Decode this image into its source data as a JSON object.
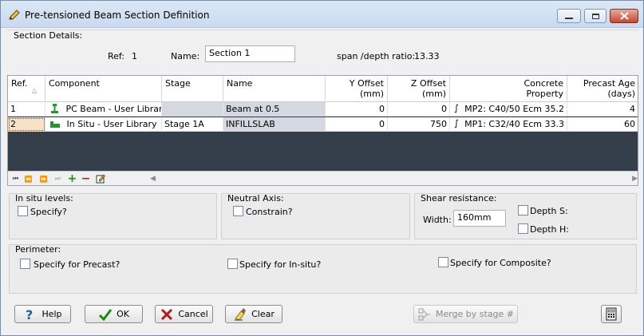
{
  "window": {
    "title": "Pre-tensioned Beam Section Definition"
  },
  "section_details": {
    "group_label": "Section Details:",
    "ref_label": "Ref:",
    "ref_value": "1",
    "name_label": "Name:",
    "name_value": "Section 1",
    "ratio_label": "span /depth ratio:",
    "ratio_value": "13.33"
  },
  "grid": {
    "headers": {
      "ref": "Ref.",
      "component": "Component",
      "stage": "Stage",
      "name": "Name",
      "y_offset_1": "Y Offset",
      "y_offset_2": "(mm)",
      "z_offset_1": "Z Offset",
      "z_offset_2": "(mm)",
      "concrete_1": "Concrete",
      "concrete_2": "Property",
      "age_1": "Precast Age",
      "age_2": "(days)"
    },
    "rows": [
      {
        "ref": "1",
        "component": "PC Beam - User Library",
        "stage": "",
        "name": "Beam at 0.5",
        "y_offset": "0",
        "z_offset": "0",
        "concrete": "MP2: C40/50 Ecm 35.2",
        "age": "4"
      },
      {
        "ref": "2",
        "component": "In Situ - User Library",
        "stage": "Stage 1A",
        "name": "INFILLSLAB",
        "y_offset": "0",
        "z_offset": "750",
        "concrete": "MP1: C32/40 Ecm 33.3",
        "age": "60"
      }
    ]
  },
  "insitu": {
    "title": "In situ levels:",
    "specify_label": "Specify?"
  },
  "neutral_axis": {
    "title": "Neutral Axis:",
    "constrain_label": "Constrain?"
  },
  "shear": {
    "title": "Shear resistance:",
    "width_label": "Width:",
    "width_value": "160mm",
    "depth_s_label": "Depth S:",
    "depth_h_label": "Depth H:"
  },
  "perimeter": {
    "title": "Perimeter:",
    "precast_label": "Specify for Precast?",
    "insitu_label": "Specify for In-situ?",
    "composite_label": "Specify for Composite?"
  },
  "buttons": {
    "help": "Help",
    "ok": "OK",
    "cancel": "Cancel",
    "clear": "Clear",
    "merge": "Merge by stage #"
  },
  "icons": {
    "title": "pencil-icon",
    "help": "question-icon",
    "ok": "checkmark-icon",
    "cancel": "x-icon",
    "clear": "eraser-icon",
    "merge": "merge-icon",
    "calculator": "calculator-icon"
  }
}
